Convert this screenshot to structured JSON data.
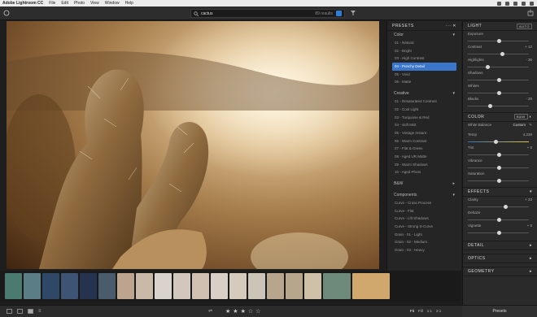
{
  "menubar": {
    "app": "Adobe Lightroom CC",
    "items": [
      "File",
      "Edit",
      "Photo",
      "View",
      "Window",
      "Help"
    ]
  },
  "search": {
    "query": "cactus",
    "results": "89 results"
  },
  "presets_panel": {
    "title": "PRESETS",
    "groups": [
      {
        "name": "Color",
        "items": [
          "01 - Natural",
          "02 - Bright",
          "03 - High Contrast",
          "04 - Punchy Detail",
          "05 - Vivid",
          "06 - Matte"
        ],
        "selected": 3
      },
      {
        "name": "Creative",
        "items": [
          "01 - Desaturated Contrast",
          "02 - Cool Light",
          "03 - Turquoise & Red",
          "04 - Soft Mist",
          "05 - Vintage Instant",
          "06 - Warm Contrast",
          "07 - Flat & Green",
          "08 - Aged UR Matte",
          "09 - Warm Shadows",
          "10 - Aged Photo"
        ]
      },
      {
        "name": "B&W",
        "items": []
      },
      {
        "name": "Components",
        "items": [
          "Curve - Cross Process",
          "Curve - Flat",
          "Curve - Lift Shadows",
          "Curve - Strong S-Curve",
          "Grain - 01 - Light",
          "Grain - 02 - Medium",
          "Grain - 03 - Heavy"
        ]
      }
    ]
  },
  "edit_panel": {
    "light": {
      "title": "LIGHT",
      "auto": "AUTO",
      "sliders": [
        {
          "label": "Exposure",
          "value": "",
          "pos": 0.5
        },
        {
          "label": "Contrast",
          "value": "+ 12",
          "pos": 0.56
        },
        {
          "label": "Highlights",
          "value": "- 36",
          "pos": 0.32
        },
        {
          "label": "Shadows",
          "value": "",
          "pos": 0.5
        },
        {
          "label": "Whites",
          "value": "",
          "pos": 0.5
        },
        {
          "label": "Blacks",
          "value": "- 29",
          "pos": 0.36
        }
      ]
    },
    "color": {
      "title": "COLOR",
      "bw": "B&W",
      "wb_label": "White Balance",
      "wb_value": "Custom",
      "temp": {
        "label": "Temp",
        "value": "4,238",
        "pos": 0.45
      },
      "sliders": [
        {
          "label": "Tint",
          "value": "+ 0",
          "pos": 0.5
        },
        {
          "label": "Vibrance",
          "value": "",
          "pos": 0.5
        },
        {
          "label": "Saturation",
          "value": "",
          "pos": 0.5
        }
      ]
    },
    "effects": {
      "title": "EFFECTS",
      "sliders": [
        {
          "label": "Clarity",
          "value": "+ 23",
          "pos": 0.61
        },
        {
          "label": "Dehaze",
          "value": "",
          "pos": 0.5
        },
        {
          "label": "Vignette",
          "value": "+ 0",
          "pos": 0.5
        }
      ]
    },
    "collapsed": [
      "DETAIL",
      "OPTICS",
      "GEOMETRY"
    ]
  },
  "bottombar": {
    "fit": "Fit",
    "fill": "Fill",
    "ratio1": "1:1",
    "ratio2": "2:1",
    "presets_button": "Presets",
    "rating": 3
  },
  "filmstrip": {
    "thumbnails": [
      "#4a7a70",
      "#5b7e86",
      "#2f4868",
      "#3d5474",
      "#26334f",
      "#4a5c6c",
      "#bca48e",
      "#c9b9a9",
      "#d9d3cc",
      "#d2c7bd",
      "#cfc0b2",
      "#d8d0c6",
      "#d5cbbd",
      "#cbc5b8",
      "#b7a58e",
      "#b8a68c",
      "#cfc1a8",
      "#6d8a7a",
      "#d0a86e"
    ]
  }
}
